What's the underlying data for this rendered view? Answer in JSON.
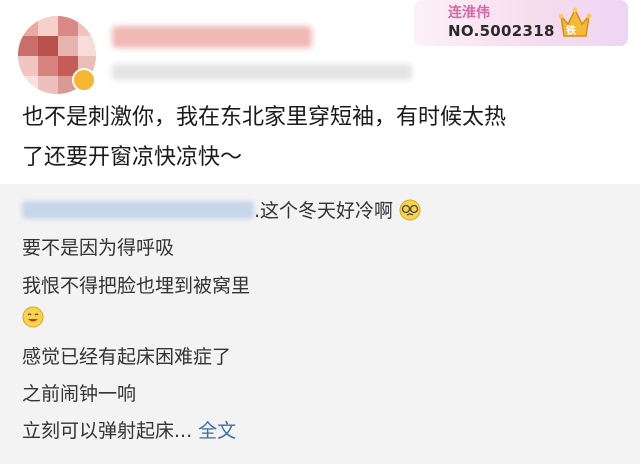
{
  "user": {
    "avatar_icon": "blurred-avatar",
    "verified_icon": "verified-badge-icon"
  },
  "fan_badge": {
    "name": "连淮伟",
    "number": "NO.5002318",
    "level_label": "铁",
    "icon": "crown-icon"
  },
  "post": {
    "line1": "也不是刺激你，我在东北家里穿短袖，有时候太热",
    "line2": "了还要开窗凉快凉快～"
  },
  "repost": {
    "line1_suffix": ".这个冬天好冷啊",
    "line2": "要不是因为得呼吸",
    "line3": "我恨不得把脸也埋到被窝里",
    "line4_emoji": "smile-emoji",
    "line5": "感觉已经有起床困难症了",
    "line6": "之前闹钟一响",
    "line7": "立刻可以弹射起床...",
    "full_text_link": "全文"
  },
  "colors": {
    "link": "#3d6ea5",
    "fan_name": "#d46aa6",
    "repost_bg": "#f3f3f3"
  }
}
